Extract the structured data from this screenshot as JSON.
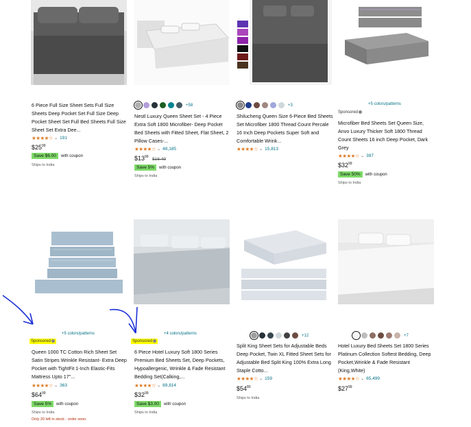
{
  "colors": {
    "star": "#de7921",
    "link": "#007185",
    "coupon_badge": "#7FDA69",
    "highlight": "#ffff00",
    "annotation_arrow": "#1a2fd6",
    "stock_warning": "#B12704"
  },
  "products": [
    {
      "title": "6 Piece Full Size Sheet Sets Full Size Sheets Deep Pocket Set Full Size Deep Pocket Sheet Set Full Bed Sheets Full Size Sheet Set Extra Dee...",
      "stars": "★★★★☆",
      "rating_count": "191",
      "price_whole": "$25",
      "price_frac": "99",
      "coupon_badge": "Save $6.00",
      "coupon_text": "with coupon",
      "ships": "Ships to India"
    },
    {
      "swatch_colors": [
        "#b0b0b0",
        "#b39ddb",
        "#263238",
        "#1b5e20",
        "#00838f",
        "#455a64"
      ],
      "swatch_more": "+58",
      "title": "Nestl Luxury Queen Sheet Set - 4 Piece Extra Soft 1800 Microfiber- Deep Pocket Bed Sheets with Fitted Sheet, Flat Sheet, 2 Pillow Cases-...",
      "stars": "★★★★☆",
      "rating_count": "48,185",
      "price_whole": "$13",
      "price_frac": "99",
      "list_price": "$16.49",
      "coupon_badge": "Save 5%",
      "coupon_text": "with coupon",
      "ships": "Ships to India"
    },
    {
      "swatch_colors": [
        "#8a8a8a",
        "#1f3f8a",
        "#6d4c41",
        "#a1887f",
        "#9fa8da",
        "#cfd8dc"
      ],
      "swatch_more": "+3",
      "title": "Shilucheng Queen Size 6-Piece Bed Sheets Set Microfiber 1800 Thread Count Percale 16 Inch Deep Pockets Super Soft and Comfortable Wrink...",
      "stars": "★★★★☆",
      "rating_count": "15,813",
      "ships": ""
    },
    {
      "colors_link": "+5 colors/patterns",
      "sponsored": "Sponsored",
      "title": "Microfiber Bed Sheets Set Queen Size, Anvo Luxury Thicker Soft 1800 Thread Count Sheets 16 inch Deep Pocket, Dark Grey",
      "stars": "★★★★☆",
      "rating_count": "397",
      "price_whole": "$32",
      "price_frac": "99",
      "coupon_badge": "Save 50%",
      "coupon_text": "with coupon",
      "ships": "Ships to India"
    },
    {
      "colors_link": "+5 colors/patterns",
      "sponsored": "Sponsored",
      "title": "Queen 1000 TC Cotton Rich Sheet Set Satin Stripes Wrinkle Resistant- Extra Deep Pocket with TightFit 1-Inch Elastic-Fits Mattress Upto 17\"...",
      "stars": "★★★★☆",
      "rating_count": "363",
      "price_whole": "$64",
      "price_frac": "99",
      "coupon_badge": "Save 5%",
      "coupon_text": "with coupon",
      "ships": "Ships to India",
      "stock": "Only 20 left in stock - order soon."
    },
    {
      "colors_link": "+4 colors/patterns",
      "sponsored": "Sponsored",
      "title": "6 Piece Hotel Luxury Soft 1800 Series Premium Bed Sheets Set, Deep Pockets, Hypoallergenic, Wrinkle & Fade Resistant Bedding Set(Calking,...",
      "stars": "★★★★☆",
      "rating_count": "89,814",
      "price_whole": "$32",
      "price_frac": "99",
      "coupon_badge": "Save $3.00",
      "coupon_text": "with coupon",
      "ships": "Ships to India"
    },
    {
      "swatch_colors": [
        "#9e9e9e",
        "#263238",
        "#37474f",
        "#cfd8dc",
        "#424242",
        "#6d4c41"
      ],
      "swatch_more": "+12",
      "title": "Split King Sheet Sets for Adjustable Beds Deep Pocket, Twin XL Fitted Sheet Sets for Adjustable Bed Split King 100% Extra Long Staple Cotto...",
      "stars": "★★★★☆",
      "rating_count": "159",
      "price_whole": "$54",
      "price_frac": "80",
      "ships": "Ships to India"
    },
    {
      "swatch_colors": [
        "#f5f5f5",
        "#bdbdbd",
        "#8d6e63",
        "#6d4c41",
        "#9e7c74",
        "#c7b2a8"
      ],
      "swatch_more": "+7",
      "title": "Hotel Luxury Bed Sheets Set 1800 Series Platinum Collection Softest Bedding, Deep Pocket,Wrinkle & Fade Resistant (King,White)",
      "stars": "★★★★☆",
      "rating_count": "65,499",
      "price_whole": "$27",
      "price_frac": "99",
      "ships": "Ships to India"
    }
  ]
}
